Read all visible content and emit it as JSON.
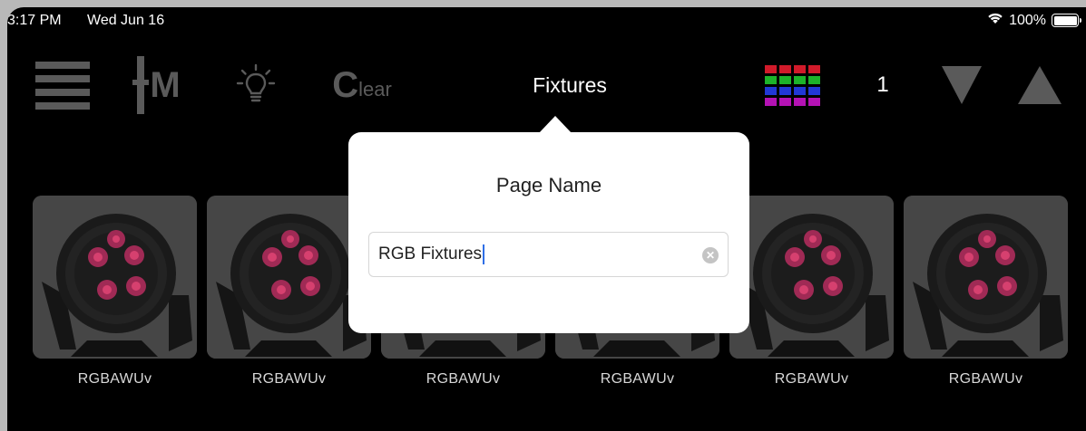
{
  "status_bar": {
    "time": "3:17 PM",
    "date": "Wed Jun 16",
    "battery": "100%",
    "battery_level": 1.0
  },
  "toolbar": {
    "menu_icon": "hamburger-menu-icon",
    "master_letter": "M",
    "bulb_icon": "lightbulb-icon",
    "clear_big": "C",
    "clear_small": "lear",
    "page_title": "Fixtures",
    "grid_colors": [
      "#d11a2a",
      "#1db32a",
      "#2138d6",
      "#b412b4"
    ],
    "page_number": "1",
    "down_icon": "triangle-down-icon",
    "up_icon": "triangle-up-icon"
  },
  "fixtures": [
    {
      "label": "RGBAWUv"
    },
    {
      "label": "RGBAWUv"
    },
    {
      "label": "RGBAWUv"
    },
    {
      "label": "RGBAWUv"
    },
    {
      "label": "RGBAWUv"
    },
    {
      "label": "RGBAWUv"
    }
  ],
  "popover": {
    "title": "Page Name",
    "input_value": "RGB Fixtures",
    "clear_icon": "clear-field-icon"
  },
  "colors": {
    "background": "#000000",
    "toolbar_icon": "#5a5a5a",
    "caret": "#2f6fe6"
  }
}
